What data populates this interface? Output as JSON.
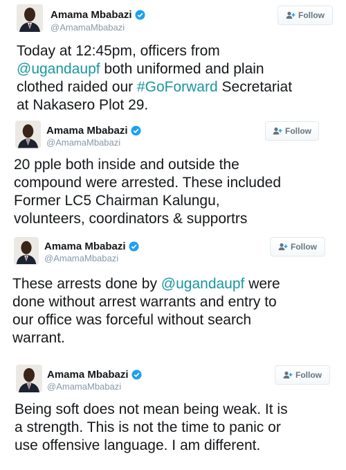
{
  "colors": {
    "link": "#1b95a0",
    "verified": "#1da1f2",
    "handle": "#8899a6",
    "text": "#14171a"
  },
  "tweets": [
    {
      "author": "Amama Mbabazi",
      "handle": "@AmamaMbabazi",
      "follow_label": "Follow",
      "lines": [
        [
          {
            "t": "Today at 12:45pm, officers from"
          }
        ],
        [
          {
            "t": "@ugandaupf",
            "k": "mention"
          },
          {
            "t": " both uniformed and plain"
          }
        ],
        [
          {
            "t": "clothed raided our "
          },
          {
            "t": "#GoForward",
            "k": "hashtag"
          },
          {
            "t": " Secretariat"
          }
        ],
        [
          {
            "t": "at Nakasero Plot 29."
          }
        ]
      ]
    },
    {
      "author": "Amama Mbabazi",
      "handle": "@AmamaMbabazi",
      "follow_label": "Follow",
      "lines": [
        [
          {
            "t": "20 pple both inside and outside the"
          }
        ],
        [
          {
            "t": "compound were arrested. These included"
          }
        ],
        [
          {
            "t": "Former LC5 Chairman Kalungu,"
          }
        ],
        [
          {
            "t": "volunteers, coordinators & supportrs"
          }
        ]
      ]
    },
    {
      "author": "Amama Mbabazi",
      "handle": "@AmamaMbabazi",
      "follow_label": "Follow",
      "lines": [
        [
          {
            "t": "These arrests done by "
          },
          {
            "t": "@ugandaupf",
            "k": "mention"
          },
          {
            "t": " were"
          }
        ],
        [
          {
            "t": "done without arrest warrants and entry to"
          }
        ],
        [
          {
            "t": "our office was forceful without search"
          }
        ],
        [
          {
            "t": "warrant."
          }
        ]
      ]
    },
    {
      "author": "Amama Mbabazi",
      "handle": "@AmamaMbabazi",
      "follow_label": "Follow",
      "lines": [
        [
          {
            "t": "Being soft does not mean being weak. It is"
          }
        ],
        [
          {
            "t": "a strength. This is not the time to panic or"
          }
        ],
        [
          {
            "t": "use offensive language. I am different."
          }
        ]
      ]
    }
  ]
}
